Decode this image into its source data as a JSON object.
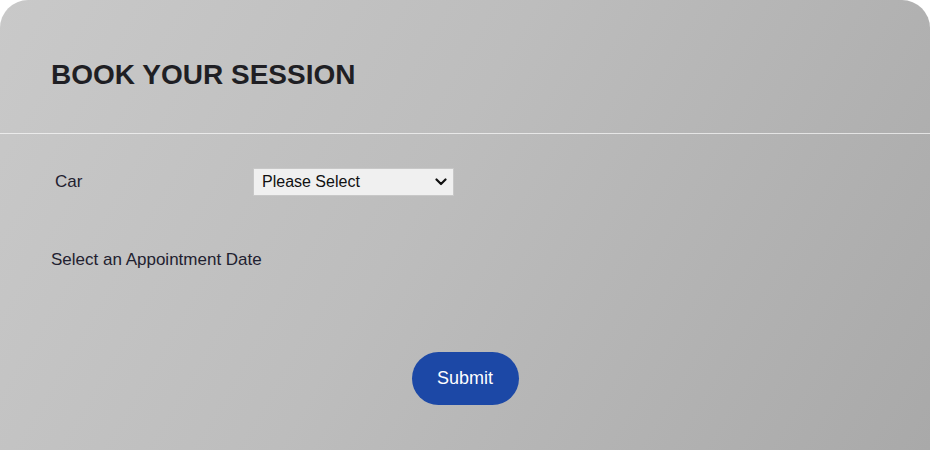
{
  "form": {
    "title": "BOOK YOUR SESSION",
    "fields": [
      {
        "label": "Car",
        "kind": "select",
        "value": "Please Select"
      },
      {
        "label": "Select an Appointment Date",
        "kind": "date"
      }
    ],
    "submit": "Submit"
  }
}
